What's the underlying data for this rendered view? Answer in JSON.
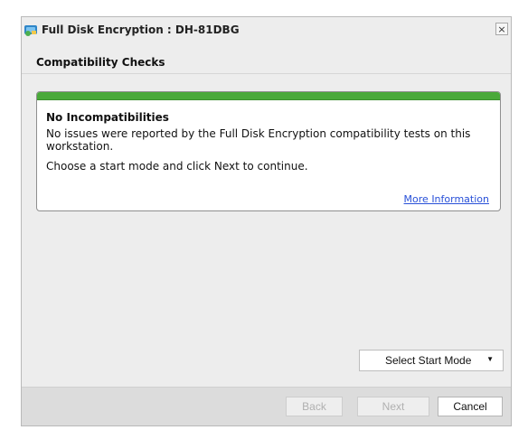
{
  "window": {
    "title": "Full Disk Encryption : DH-81DBG",
    "close_glyph": "×"
  },
  "page": {
    "section_title": "Compatibility Checks"
  },
  "result_card": {
    "status_color": "#4aa93a",
    "heading": "No Incompatibilities",
    "message": "No issues were reported by the Full Disk Encryption compatibility tests on this workstation.",
    "instruction": "Choose a start mode and click Next to continue.",
    "more_info_link": "More Information"
  },
  "start_mode": {
    "selected": "Select Start Mode"
  },
  "footer": {
    "back_label": "Back",
    "next_label": "Next",
    "cancel_label": "Cancel"
  },
  "icons": {
    "app": "disk-encryption-icon",
    "close": "close-icon",
    "dropdown": "chevron-down-icon"
  }
}
